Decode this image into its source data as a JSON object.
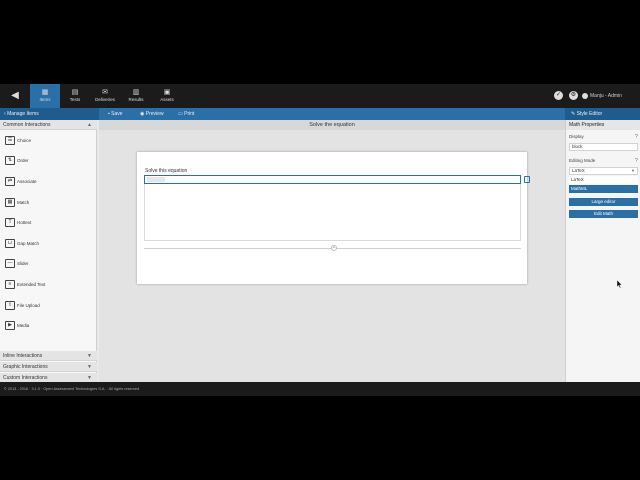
{
  "topnav": {
    "back_icon": "arrow-left-icon",
    "tabs": [
      {
        "label": "Items",
        "icon": "items-icon",
        "active": true
      },
      {
        "label": "Tests",
        "icon": "tests-icon",
        "active": false
      },
      {
        "label": "Deliveries",
        "icon": "deliveries-icon",
        "active": false
      },
      {
        "label": "Results",
        "icon": "results-icon",
        "active": false
      },
      {
        "label": "Assets",
        "icon": "assets-icon",
        "active": false
      }
    ],
    "user_label": "Manju - Admin"
  },
  "actionbar": {
    "manage_items": "Manage Items",
    "save": "Save",
    "preview": "Preview",
    "print": "Print",
    "style_editor": "Style Editor"
  },
  "leftpanel": {
    "common_header": "Common Interactions",
    "items": [
      {
        "label": "Choice",
        "icon": "choice-icon"
      },
      {
        "label": "Order",
        "icon": "order-icon"
      },
      {
        "label": "Associate",
        "icon": "associate-icon"
      },
      {
        "label": "Match",
        "icon": "match-icon"
      },
      {
        "label": "Hottext",
        "icon": "hottext-icon"
      },
      {
        "label": "Gap Match",
        "icon": "gap-match-icon"
      },
      {
        "label": "Slider",
        "icon": "slider-icon"
      },
      {
        "label": "Extended Text",
        "icon": "extended-text-icon"
      },
      {
        "label": "File Upload",
        "icon": "file-upload-icon"
      },
      {
        "label": "Media",
        "icon": "media-icon"
      }
    ],
    "inline_header": "Inline Interactions",
    "graphic_header": "Graphic Interactions",
    "custom_header": "Custom Interactions"
  },
  "center": {
    "title": "Solve the equation",
    "prompt": "Solve this equation"
  },
  "rightpanel": {
    "title": "Math Properties",
    "display_label": "Display",
    "display_value": "block",
    "editing_mode_label": "Editing Mode",
    "editing_mode_value": "LaTeX",
    "options": [
      "LaTeX",
      "MathML"
    ],
    "selected_option": "MathML",
    "large_editor_button": "Large editor",
    "edit_math_button": "Edit Math"
  },
  "footer": {
    "text": "© 2013 - 2016 · 3.1.0 · Open Assessment Technologies S.A. · All rights reserved"
  },
  "colors": {
    "accent": "#2a6fa6",
    "topbar": "#1b1b1b",
    "canvas": "#e3e3e3"
  }
}
